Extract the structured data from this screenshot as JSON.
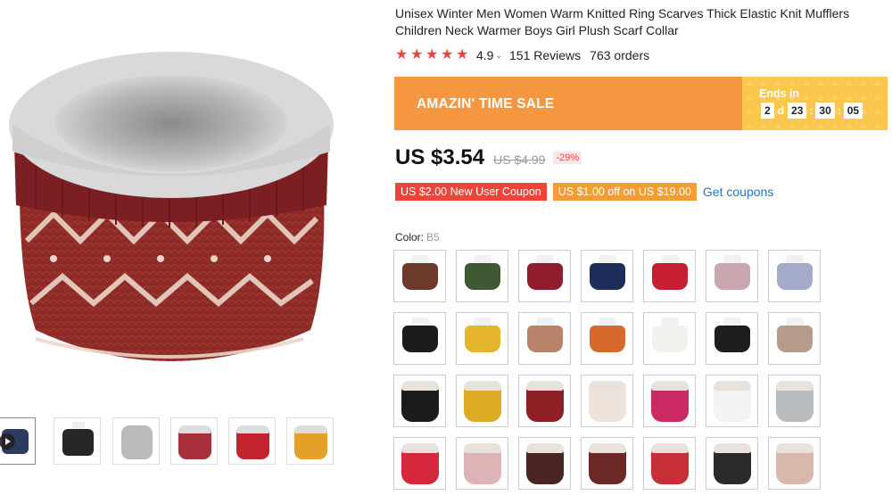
{
  "product": {
    "title": "Unisex Winter Men Women Warm Knitted Ring Scarves Thick Elastic Knit Mufflers Children Neck Warmer Boys Girl Plush Scarf Collar",
    "rating": "4.9",
    "reviews": "151 Reviews",
    "orders": "763 orders"
  },
  "sale": {
    "label": "AMAZIN' TIME SALE",
    "ends_label": "Ends in",
    "days": "2",
    "days_unit": "d",
    "hours": "23",
    "minutes": "30",
    "seconds": "05",
    "sep": ":"
  },
  "price": {
    "current": "US $3.54",
    "original": "US $4.99",
    "discount": "-29%"
  },
  "coupons": {
    "new_user": "US $2.00 New User Coupon",
    "store": "US $1.00 off on US $19.00",
    "get_link": "Get coupons"
  },
  "color": {
    "label": "Color:",
    "selected": "B5"
  },
  "icons": {
    "star": "star-icon",
    "play": "play-icon",
    "chevron": "chevron-down-icon"
  },
  "colors": {
    "brand_red": "#f0433a",
    "sale_orange": "#f59740",
    "countdown_yellow": "#f9c74e",
    "link_blue": "#2a75c0"
  },
  "swatch_colors": [
    [
      "#6b3a2a",
      "#3f5a33",
      "#8f1d2d",
      "#1f2d5a",
      "#c81e34",
      "#c9a7ae",
      "#a4abc8"
    ],
    [
      "#1c1c1c",
      "#e6b52e",
      "#b88369",
      "#d56a2c",
      "#f3f1ee",
      "#1d1d1d",
      "#b49b8a"
    ],
    [
      "#1b1b1b",
      "#dcaa24",
      "#8e1f24",
      "#efe4db",
      "#c92a63",
      "#f3f3f3",
      "#b9bcbf"
    ],
    [
      "#d6283c",
      "#ddb3b6",
      "#4a2420",
      "#6b2824",
      "#c83038",
      "#2a2a2a",
      "#d8b8ad"
    ]
  ],
  "thumb_colors": [
    "#2c3b5f",
    "#272727",
    "#bbbbbb",
    "#a7303a",
    "#c4242d",
    "#e3a12a"
  ]
}
